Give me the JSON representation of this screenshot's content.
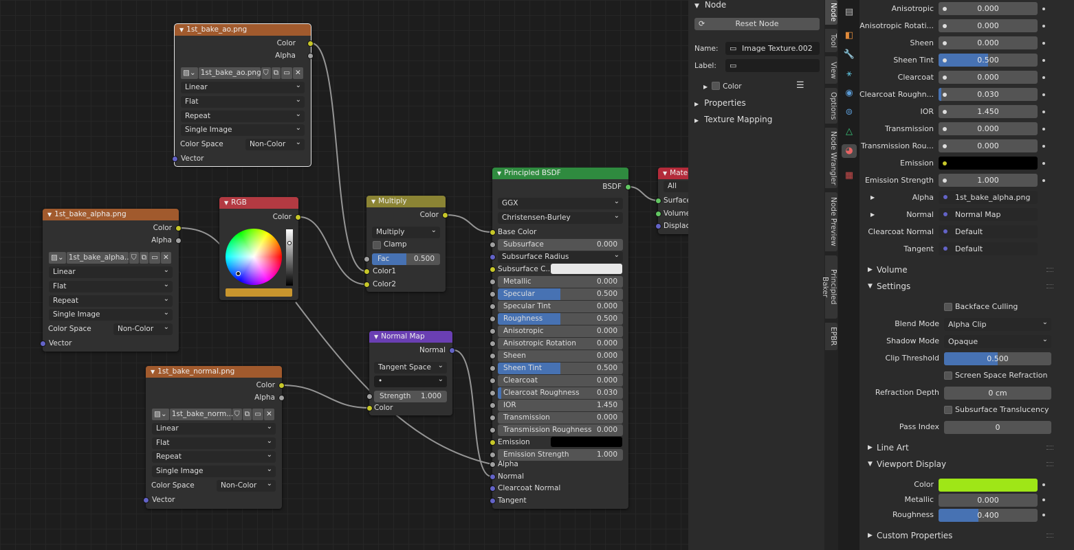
{
  "nodes": {
    "ao": {
      "title": "1st_bake_ao.png",
      "out_color": "Color",
      "out_alpha": "Alpha",
      "image": "1st_bake_ao.png",
      "interp": "Linear",
      "proj": "Flat",
      "ext": "Repeat",
      "src": "Single Image",
      "cs_label": "Color Space",
      "cs": "Non-Color",
      "in_vector": "Vector"
    },
    "alpha": {
      "title": "1st_bake_alpha.png",
      "out_color": "Color",
      "out_alpha": "Alpha",
      "image": "1st_bake_alpha...",
      "interp": "Linear",
      "proj": "Flat",
      "ext": "Repeat",
      "src": "Single Image",
      "cs_label": "Color Space",
      "cs": "Non-Color",
      "in_vector": "Vector"
    },
    "normal": {
      "title": "1st_bake_normal.png",
      "out_color": "Color",
      "out_alpha": "Alpha",
      "image": "1st_bake_norm...",
      "interp": "Linear",
      "proj": "Flat",
      "ext": "Repeat",
      "src": "Single Image",
      "cs_label": "Color Space",
      "cs": "Non-Color",
      "in_vector": "Vector"
    },
    "rgb": {
      "title": "RGB",
      "out_color": "Color",
      "swatch": "#c9962e"
    },
    "multiply": {
      "title": "Multiply",
      "out_color": "Color",
      "mode": "Multiply",
      "clamp": "Clamp",
      "fac_label": "Fac",
      "fac": "0.500",
      "fac_pct": 50,
      "c1": "Color1",
      "c2": "Color2"
    },
    "normalmap": {
      "title": "Normal Map",
      "out_normal": "Normal",
      "space": "Tangent Space",
      "uv": "•",
      "strength_label": "Strength",
      "strength": "1.000",
      "in_color": "Color"
    },
    "bsdf": {
      "title": "Principled BSDF",
      "out": "BSDF",
      "dist": "GGX",
      "sss": "Christensen-Burley",
      "base_color": "Base Color",
      "fields": [
        {
          "label": "Subsurface",
          "value": "0.000",
          "pct": 0
        },
        {
          "label": "Subsurface Radius",
          "value": "",
          "pct": 0,
          "dropdown": true
        },
        {
          "label": "Subsurface C...",
          "value": "",
          "pct": 0,
          "color": "#e8e8e8"
        },
        {
          "label": "Metallic",
          "value": "0.000",
          "pct": 0
        },
        {
          "label": "Specular",
          "value": "0.500",
          "pct": 50
        },
        {
          "label": "Specular Tint",
          "value": "0.000",
          "pct": 0
        },
        {
          "label": "Roughness",
          "value": "0.500",
          "pct": 50
        },
        {
          "label": "Anisotropic",
          "value": "0.000",
          "pct": 0
        },
        {
          "label": "Anisotropic Rotation",
          "value": "0.000",
          "pct": 0
        },
        {
          "label": "Sheen",
          "value": "0.000",
          "pct": 0
        },
        {
          "label": "Sheen Tint",
          "value": "0.500",
          "pct": 50
        },
        {
          "label": "Clearcoat",
          "value": "0.000",
          "pct": 0
        },
        {
          "label": "Clearcoat Roughness",
          "value": "0.030",
          "pct": 3
        },
        {
          "label": "IOR",
          "value": "1.450",
          "pct": 0
        },
        {
          "label": "Transmission",
          "value": "0.000",
          "pct": 0
        },
        {
          "label": "Transmission Roughness",
          "value": "0.000",
          "pct": 0
        },
        {
          "label": "Emission",
          "value": "",
          "pct": 0,
          "color": "#000000"
        },
        {
          "label": "Emission Strength",
          "value": "1.000",
          "pct": 0
        }
      ],
      "alpha": "Alpha",
      "normal": "Normal",
      "cc_normal": "Clearcoat Normal",
      "tangent": "Tangent"
    },
    "output": {
      "title": "Mater",
      "target": "All",
      "surface": "Surface",
      "volume": "Volume",
      "displace": "Displace"
    }
  },
  "npanel": {
    "header": "Node",
    "reset": "Reset Node",
    "name_label": "Name:",
    "name": "Image Texture.002",
    "label_label": "Label:",
    "label": "",
    "color": "Color",
    "properties": "Properties",
    "texmap": "Texture Mapping"
  },
  "tabs": [
    "Node",
    "Tool",
    "View",
    "Options",
    "Node Wrangler",
    "Node Preview",
    "Principled Baker",
    "EPBR"
  ],
  "props": {
    "rows": [
      {
        "label": "Anisotropic",
        "value": "0.000",
        "pct": 0
      },
      {
        "label": "Anisotropic Rotati...",
        "value": "0.000",
        "pct": 0
      },
      {
        "label": "Sheen",
        "value": "0.000",
        "pct": 0
      },
      {
        "label": "Sheen Tint",
        "value": "0.500",
        "pct": 50
      },
      {
        "label": "Clearcoat",
        "value": "0.000",
        "pct": 0
      },
      {
        "label": "Clearcoat Roughn...",
        "value": "0.030",
        "pct": 3
      },
      {
        "label": "IOR",
        "value": "1.450",
        "pct": 0
      },
      {
        "label": "Transmission",
        "value": "0.000",
        "pct": 0
      },
      {
        "label": "Transmission Rou...",
        "value": "0.000",
        "pct": 0
      },
      {
        "label": "Emission",
        "value": "",
        "pct": 0,
        "color": "#000000"
      },
      {
        "label": "Emission Strength",
        "value": "1.000",
        "pct": 0
      },
      {
        "label": "Alpha",
        "value": "1st_bake_alpha.png",
        "link": true
      },
      {
        "label": "Normal",
        "value": "Normal Map",
        "link": true
      },
      {
        "label": "Clearcoat Normal",
        "value": "Default",
        "link": true
      },
      {
        "label": "Tangent",
        "value": "Default",
        "link": true
      }
    ],
    "volume": "Volume",
    "settings": "Settings",
    "backface": "Backface Culling",
    "blend_label": "Blend Mode",
    "blend": "Alpha Clip",
    "shadow_label": "Shadow Mode",
    "shadow": "Opaque",
    "clip_label": "Clip Threshold",
    "clip": "0.500",
    "clip_pct": 50,
    "ssr": "Screen Space Refraction",
    "refr_label": "Refraction Depth",
    "refr": "0 cm",
    "sst": "Subsurface Translucency",
    "pass_label": "Pass Index",
    "pass": "0",
    "lineart": "Line Art",
    "viewport": "Viewport Display",
    "vp_color_label": "Color",
    "vp_color": "#9fe617",
    "vp_metal_label": "Metallic",
    "vp_metal": "0.000",
    "vp_rough_label": "Roughness",
    "vp_rough": "0.400",
    "vp_rough_pct": 40,
    "custom": "Custom Properties"
  }
}
